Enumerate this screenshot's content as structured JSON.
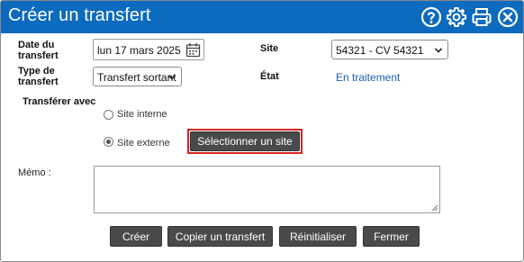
{
  "window": {
    "title": "Créer un transfert",
    "icons": [
      "help-icon",
      "gear-icon",
      "print-icon",
      "close-icon"
    ]
  },
  "form": {
    "transfer_date_label": "Date du transfert",
    "transfer_date_value": "lun 17 mars 2025",
    "transfer_type_label": "Type de transfert",
    "transfer_type_value": "Transfert sortant",
    "site_label": "Site",
    "site_value": "54321 - CV 54321",
    "state_label": "État",
    "state_value": "En traitement",
    "transfer_with_label": "Transférer avec",
    "options": [
      {
        "label": "Site interne",
        "checked": false
      },
      {
        "label": "Site externe",
        "checked": true
      }
    ],
    "select_site_label": "Sélectionner un site",
    "memo_label": "Mémo :",
    "memo_value": ""
  },
  "actions": {
    "create": "Créer",
    "copy": "Copier un transfert",
    "reset": "Réinitialiser",
    "close": "Fermer"
  },
  "colors": {
    "titlebar": "#0c6abf",
    "link": "#1a5fb4",
    "highlight": "#d9231f",
    "button": "#4a4a4a"
  }
}
